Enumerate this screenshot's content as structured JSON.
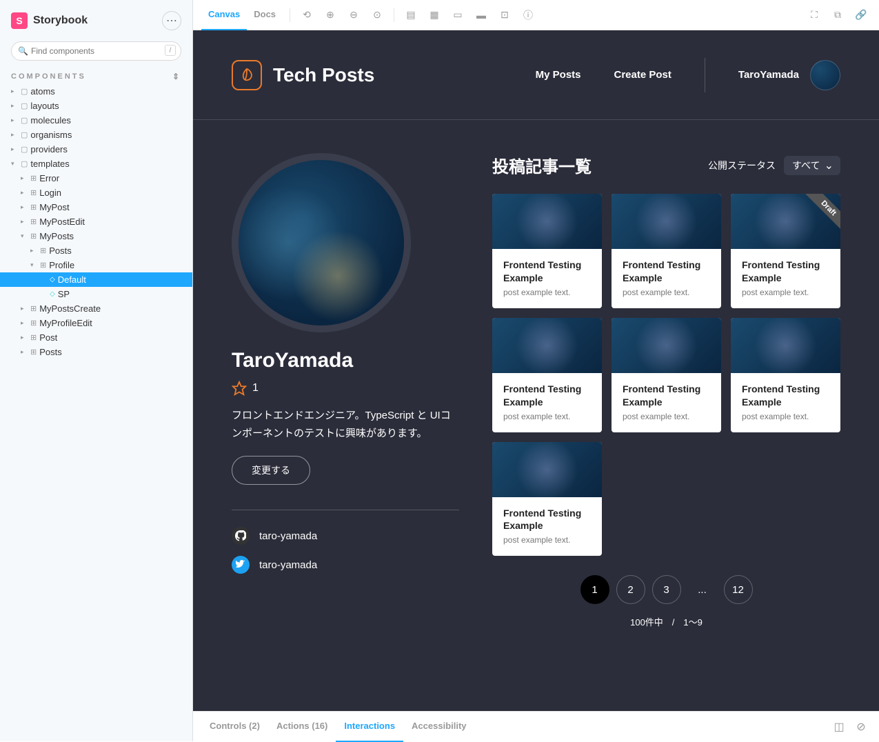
{
  "sidebar": {
    "brand": "Storybook",
    "search_placeholder": "Find components",
    "section": "COMPONENTS",
    "tree": [
      {
        "label": "atoms",
        "type": "folder",
        "indent": 0,
        "expanded": false
      },
      {
        "label": "layouts",
        "type": "folder",
        "indent": 0,
        "expanded": false
      },
      {
        "label": "molecules",
        "type": "folder",
        "indent": 0,
        "expanded": false
      },
      {
        "label": "organisms",
        "type": "folder",
        "indent": 0,
        "expanded": false
      },
      {
        "label": "providers",
        "type": "folder",
        "indent": 0,
        "expanded": false
      },
      {
        "label": "templates",
        "type": "folder",
        "indent": 0,
        "expanded": true
      },
      {
        "label": "Error",
        "type": "component",
        "indent": 1,
        "expanded": false
      },
      {
        "label": "Login",
        "type": "component",
        "indent": 1,
        "expanded": false
      },
      {
        "label": "MyPost",
        "type": "component",
        "indent": 1,
        "expanded": false
      },
      {
        "label": "MyPostEdit",
        "type": "component",
        "indent": 1,
        "expanded": false
      },
      {
        "label": "MyPosts",
        "type": "component",
        "indent": 1,
        "expanded": true
      },
      {
        "label": "Posts",
        "type": "component",
        "indent": 2,
        "expanded": false
      },
      {
        "label": "Profile",
        "type": "component",
        "indent": 2,
        "expanded": true
      },
      {
        "label": "Default",
        "type": "story",
        "indent": 3,
        "selected": true
      },
      {
        "label": "SP",
        "type": "story",
        "indent": 3
      },
      {
        "label": "MyPostsCreate",
        "type": "component",
        "indent": 1,
        "expanded": false
      },
      {
        "label": "MyProfileEdit",
        "type": "component",
        "indent": 1,
        "expanded": false
      },
      {
        "label": "Post",
        "type": "component",
        "indent": 1,
        "expanded": false
      },
      {
        "label": "Posts",
        "type": "component",
        "indent": 1,
        "expanded": false
      }
    ]
  },
  "toolbar": {
    "tabs": [
      "Canvas",
      "Docs"
    ],
    "active_tab": "Canvas"
  },
  "app": {
    "title": "Tech Posts",
    "nav": {
      "my_posts": "My Posts",
      "create_post": "Create Post",
      "username": "TaroYamada"
    },
    "profile": {
      "name": "TaroYamada",
      "star_count": "1",
      "bio": "フロントエンドエンジニア。TypeScript と UIコンポーネントのテストに興味があります。",
      "edit_btn": "変更する",
      "github": "taro-yamada",
      "twitter": "taro-yamada"
    },
    "posts": {
      "heading": "投稿記事一覧",
      "filter_label": "公開ステータス",
      "filter_value": "すべて",
      "cards": [
        {
          "title": "Frontend Testing Example",
          "desc": "post example text.",
          "draft": false
        },
        {
          "title": "Frontend Testing Example",
          "desc": "post example text.",
          "draft": false
        },
        {
          "title": "Frontend Testing Example",
          "desc": "post example text.",
          "draft": true
        },
        {
          "title": "Frontend Testing Example",
          "desc": "post example text.",
          "draft": false
        },
        {
          "title": "Frontend Testing Example",
          "desc": "post example text.",
          "draft": false
        },
        {
          "title": "Frontend Testing Example",
          "desc": "post example text.",
          "draft": false
        },
        {
          "title": "Frontend Testing Example",
          "desc": "post example text.",
          "draft": false
        }
      ],
      "draft_label": "Draft",
      "pages": [
        "1",
        "2",
        "3",
        "...",
        "12"
      ],
      "active_page": "1",
      "page_info": "100件中　/　1〜9"
    }
  },
  "addons": {
    "tabs": [
      "Controls (2)",
      "Actions (16)",
      "Interactions",
      "Accessibility"
    ],
    "active": "Interactions"
  }
}
